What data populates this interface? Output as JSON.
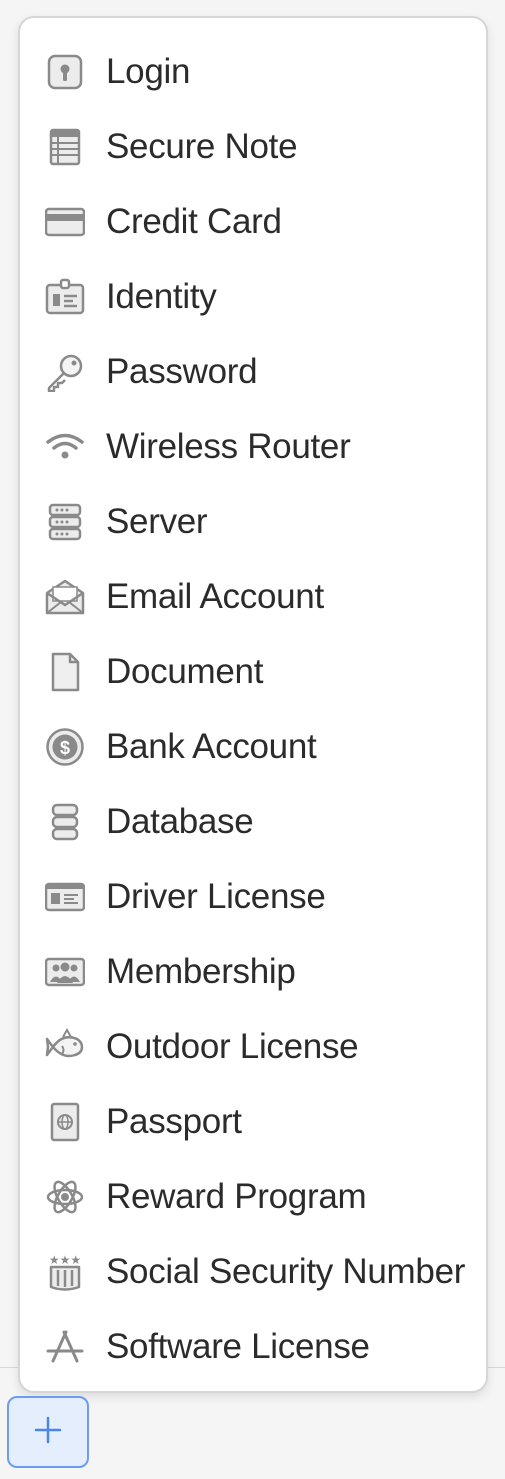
{
  "menu": {
    "items": [
      {
        "label": "Login",
        "icon": "login-icon"
      },
      {
        "label": "Secure Note",
        "icon": "secure-note-icon"
      },
      {
        "label": "Credit Card",
        "icon": "credit-card-icon"
      },
      {
        "label": "Identity",
        "icon": "identity-icon"
      },
      {
        "label": "Password",
        "icon": "password-key-icon"
      },
      {
        "label": "Wireless Router",
        "icon": "wifi-icon"
      },
      {
        "label": "Server",
        "icon": "server-icon"
      },
      {
        "label": "Email Account",
        "icon": "email-icon"
      },
      {
        "label": "Document",
        "icon": "document-icon"
      },
      {
        "label": "Bank Account",
        "icon": "bank-account-icon"
      },
      {
        "label": "Database",
        "icon": "database-icon"
      },
      {
        "label": "Driver License",
        "icon": "driver-license-icon"
      },
      {
        "label": "Membership",
        "icon": "membership-icon"
      },
      {
        "label": "Outdoor License",
        "icon": "fish-icon"
      },
      {
        "label": "Passport",
        "icon": "passport-icon"
      },
      {
        "label": "Reward Program",
        "icon": "reward-program-icon"
      },
      {
        "label": "Social Security Number",
        "icon": "social-security-icon"
      },
      {
        "label": "Software License",
        "icon": "software-license-icon"
      }
    ]
  },
  "add_button": {
    "icon": "plus-icon"
  },
  "colors": {
    "icon_gray": "#8a8a8a",
    "text": "#2b2b2b",
    "accent_blue": "#4a86e8"
  }
}
